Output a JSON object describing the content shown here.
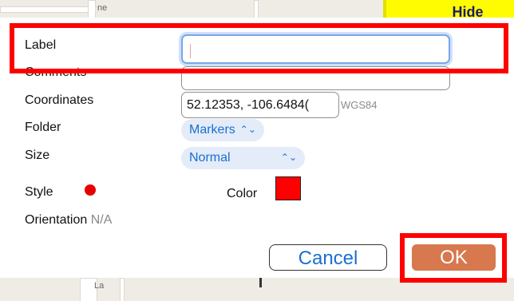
{
  "map": {
    "hide_label": "Hide",
    "street_labels": [
      "ne",
      "La"
    ]
  },
  "form": {
    "label": {
      "label": "Label",
      "value": ""
    },
    "comments": {
      "label": "Comments",
      "value": ""
    },
    "coordinates": {
      "label": "Coordinates",
      "value": "52.12353, -106.6484(",
      "unit": "WGS84"
    },
    "folder": {
      "label": "Folder",
      "value": "Markers"
    },
    "size": {
      "label": "Size",
      "value": "Normal"
    },
    "style": {
      "label": "Style",
      "dot_color": "#e80000"
    },
    "color": {
      "label": "Color",
      "value": "#ff0000"
    },
    "orientation": {
      "label": "Orientation",
      "value": "N/A"
    }
  },
  "actions": {
    "cancel": "Cancel",
    "ok": "OK"
  },
  "colors": {
    "highlight": "#ff0000",
    "ok_button": "#d7784e",
    "link_blue": "#1a6fd1"
  }
}
